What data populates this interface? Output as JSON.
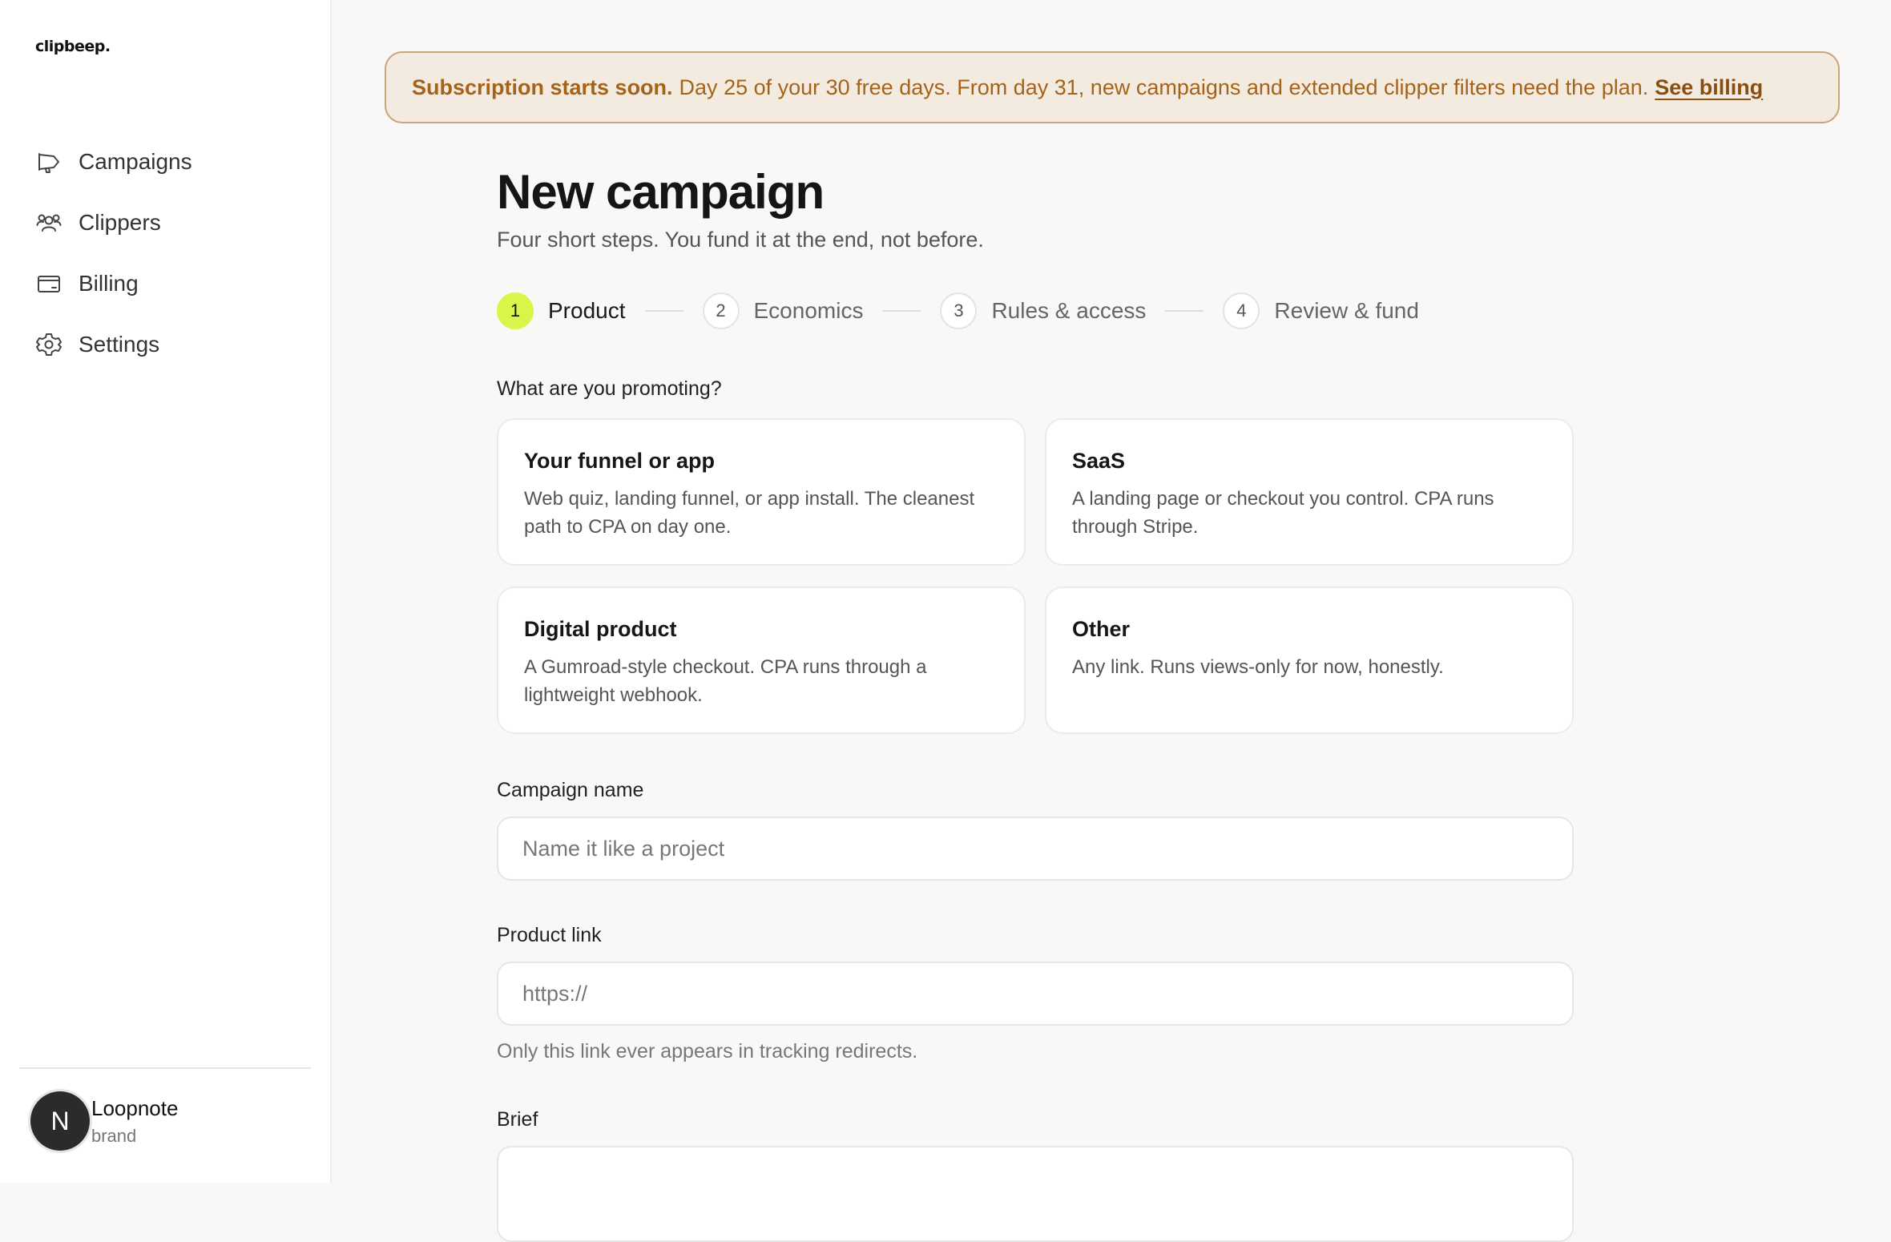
{
  "sidebar": {
    "logo": "clipbeep.",
    "items": [
      {
        "label": "Campaigns",
        "icon": "megaphone-icon"
      },
      {
        "label": "Clippers",
        "icon": "users-icon"
      },
      {
        "label": "Billing",
        "icon": "card-icon"
      },
      {
        "label": "Settings",
        "icon": "gear-icon"
      }
    ],
    "user": {
      "initial": "N",
      "name": "Loopnote",
      "role": "brand"
    }
  },
  "banner": {
    "strong": "Subscription starts soon.",
    "message": "Day 25 of your 30 free days. From day 31, new campaigns and extended clipper filters need the plan.",
    "link": "See billing"
  },
  "page": {
    "title": "New campaign",
    "subtitle": "Four short steps. You fund it at the end, not before."
  },
  "steps": [
    {
      "num": "1",
      "label": "Product",
      "active": true
    },
    {
      "num": "2",
      "label": "Economics"
    },
    {
      "num": "3",
      "label": "Rules & access"
    },
    {
      "num": "4",
      "label": "Review & fund"
    }
  ],
  "product": {
    "question": "What are you promoting?",
    "options": [
      {
        "title": "Your funnel or app",
        "desc": "Web quiz, landing funnel, or app install. The cleanest path to CPA on day one."
      },
      {
        "title": "SaaS",
        "desc": "A landing page or checkout you control. CPA runs through Stripe."
      },
      {
        "title": "Digital product",
        "desc": "A Gumroad-style checkout. CPA runs through a lightweight webhook."
      },
      {
        "title": "Other",
        "desc": "Any link. Runs views-only for now, honestly."
      }
    ]
  },
  "form": {
    "name_label": "Campaign name",
    "name_placeholder": "Name it like a project",
    "link_label": "Product link",
    "link_placeholder": "https://",
    "link_hint": "Only this link ever appears in tracking redirects.",
    "brief_label": "Brief"
  },
  "colors": {
    "accent": "#d8f64a",
    "banner_bg": "#f3ebdf",
    "banner_text": "#a5631a"
  }
}
